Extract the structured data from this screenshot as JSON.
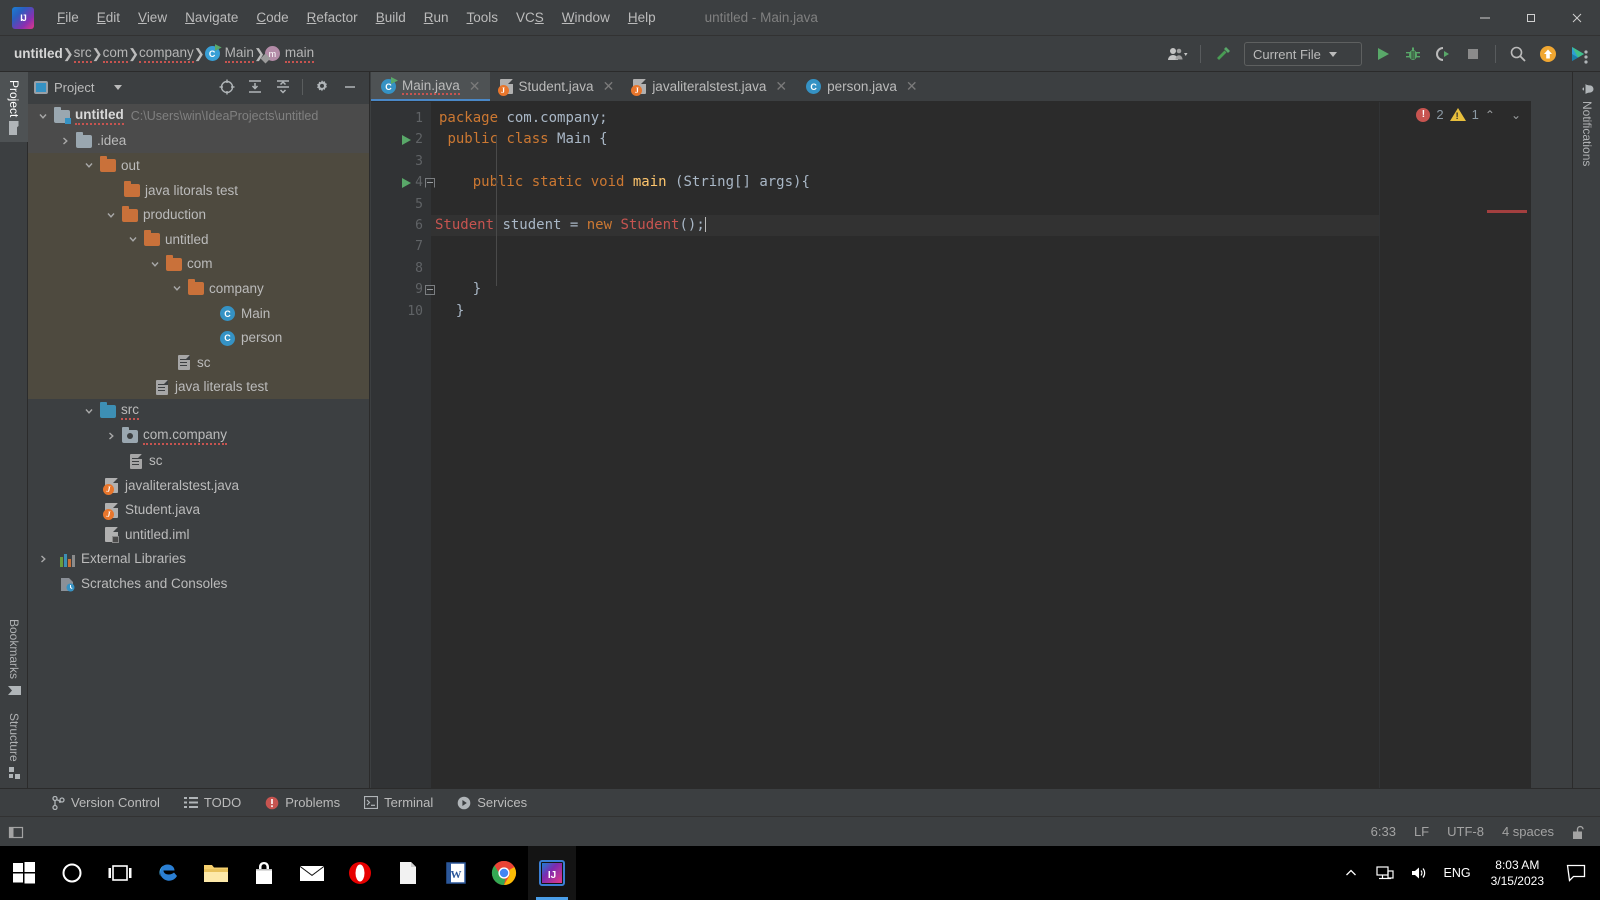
{
  "window": {
    "title": "untitled - Main.java",
    "logo_text": "IJ",
    "controls": {
      "minimize": "—",
      "maximize": "❐",
      "close": "✕"
    }
  },
  "menubar": [
    {
      "label": "File"
    },
    {
      "label": "Edit"
    },
    {
      "label": "View"
    },
    {
      "label": "Navigate"
    },
    {
      "label": "Code"
    },
    {
      "label": "Refactor"
    },
    {
      "label": "Build"
    },
    {
      "label": "Run"
    },
    {
      "label": "Tools"
    },
    {
      "label": "VCS"
    },
    {
      "label": "Window"
    },
    {
      "label": "Help"
    }
  ],
  "breadcrumbs": [
    {
      "label": "untitled",
      "icon": "none",
      "root": true
    },
    {
      "label": "src",
      "icon": "none"
    },
    {
      "label": "com",
      "icon": "none"
    },
    {
      "label": "company",
      "icon": "none"
    },
    {
      "label": "Main",
      "icon": "class-icon"
    },
    {
      "label": "main",
      "icon": "method-icon"
    }
  ],
  "nav_toolbar": {
    "account_icon": "user-icon",
    "build_icon": "hammer-icon",
    "run_config": "Current File",
    "run_icon": "run-icon",
    "debug_icon": "debug-icon",
    "run_coverage_icon": "run-with-coverage-icon",
    "stop_icon": "stop-icon",
    "search_icon": "search-icon",
    "update_icon": "update-available-icon",
    "ide_icon": "ide-services-icon"
  },
  "left_strip": {
    "top": [
      {
        "label": "Project",
        "icon": "project-folder-icon",
        "active": true
      }
    ],
    "bottom": [
      {
        "label": "Bookmarks",
        "icon": "bookmark-icon"
      },
      {
        "label": "Structure",
        "icon": "structure-icon"
      }
    ]
  },
  "right_strip": [
    {
      "label": "Notifications",
      "icon": "bell-icon"
    }
  ],
  "project_panel": {
    "title": "Project",
    "buttons": [
      "select-opened-file-icon",
      "expand-all-icon",
      "collapse-all-icon",
      "settings-gear-icon",
      "hide-icon"
    ],
    "tree": [
      {
        "depth": 0,
        "arrow": "down",
        "icon": "module-folder-icon",
        "label": "untitled",
        "bold": true,
        "path": "C:\\Users\\win\\IdeaProjects\\untitled",
        "squiggle": true,
        "hl": "sel"
      },
      {
        "depth": 1,
        "arrow": "right",
        "icon": "folder-grey-icon",
        "label": ".idea",
        "hl": "sel"
      },
      {
        "depth": 1,
        "arrow": "down",
        "icon": "folder-orange-icon",
        "label": "out",
        "hl": "out"
      },
      {
        "depth": 2,
        "arrow": "none",
        "icon": "folder-orange-icon",
        "label": "java litorals test",
        "hl": "out"
      },
      {
        "depth": 2,
        "arrow": "down",
        "icon": "folder-orange-icon",
        "label": "production",
        "hl": "out"
      },
      {
        "depth": 3,
        "arrow": "down",
        "icon": "folder-orange-icon",
        "label": "untitled",
        "hl": "out"
      },
      {
        "depth": 4,
        "arrow": "down",
        "icon": "folder-orange-icon",
        "label": "com",
        "hl": "out"
      },
      {
        "depth": 5,
        "arrow": "down",
        "icon": "folder-orange-icon",
        "label": "company",
        "hl": "out"
      },
      {
        "depth": 6,
        "arrow": "none",
        "icon": "class-icon",
        "label": "Main",
        "hl": "out"
      },
      {
        "depth": 6,
        "arrow": "none",
        "icon": "class-icon",
        "label": "person",
        "hl": "out"
      },
      {
        "depth": 4,
        "arrow": "none",
        "icon": "file-icon",
        "label": "sc",
        "hl": "out"
      },
      {
        "depth": 3,
        "arrow": "none",
        "icon": "file-icon",
        "label": "java literals test",
        "hl": "out"
      },
      {
        "depth": 1,
        "arrow": "down",
        "icon": "folder-source-icon",
        "label": "src",
        "squiggle": true
      },
      {
        "depth": 2,
        "arrow": "right",
        "icon": "package-icon",
        "label": "com.company",
        "squiggle": true
      },
      {
        "depth": 2,
        "arrow": "none",
        "icon": "file-icon",
        "label": "sc"
      },
      {
        "depth": 1,
        "arrow": "none",
        "icon": "java-file-icon",
        "label": "javaliteralstest.java"
      },
      {
        "depth": 1,
        "arrow": "none",
        "icon": "java-file-icon",
        "label": "Student.java"
      },
      {
        "depth": 1,
        "arrow": "none",
        "icon": "iml-file-icon",
        "label": "untitled.iml"
      },
      {
        "depth": 0,
        "arrow": "right",
        "icon": "external-libraries-icon",
        "label": "External Libraries"
      },
      {
        "depth": 0,
        "arrow": "none",
        "icon": "scratches-icon",
        "label": "Scratches and Consoles"
      }
    ]
  },
  "editor": {
    "tabs": [
      {
        "label": "Main.java",
        "icon": "class-run-icon",
        "active": true,
        "squiggle": true
      },
      {
        "label": "Student.java",
        "icon": "java-file-icon",
        "active": false
      },
      {
        "label": "javaliteralstest.java",
        "icon": "java-file-icon",
        "active": false
      },
      {
        "label": "person.java",
        "icon": "class-icon",
        "active": false
      }
    ],
    "gutter_numbers": [
      "1",
      "2",
      "3",
      "4",
      "5",
      "6",
      "7",
      "8",
      "9",
      "10"
    ],
    "lines": [
      {
        "n": 1,
        "runmark": false,
        "fold": "",
        "tokens": [
          {
            "t": "package ",
            "c": "kw"
          },
          {
            "t": "com.company;",
            "c": "pl"
          }
        ]
      },
      {
        "n": 2,
        "runmark": true,
        "fold": "",
        "tokens": [
          {
            "t": " ",
            "c": "pl"
          },
          {
            "t": "public class ",
            "c": "kw"
          },
          {
            "t": "Main {",
            "c": "pl"
          }
        ]
      },
      {
        "n": 3,
        "runmark": false,
        "fold": "",
        "tokens": []
      },
      {
        "n": 4,
        "runmark": true,
        "fold": "open",
        "tokens": [
          {
            "t": "    ",
            "c": "pl"
          },
          {
            "t": "public static void ",
            "c": "kw"
          },
          {
            "t": "main ",
            "c": "meth"
          },
          {
            "t": "(String[] args){",
            "c": "pl"
          }
        ]
      },
      {
        "n": 5,
        "runmark": false,
        "fold": "",
        "tokens": []
      },
      {
        "n": 6,
        "runmark": false,
        "fold": "",
        "current": true,
        "tokens": [
          {
            "t": "Student",
            "c": "err"
          },
          {
            "t": " student = ",
            "c": "pl"
          },
          {
            "t": "new ",
            "c": "kw"
          },
          {
            "t": "Student",
            "c": "err"
          },
          {
            "t": "();",
            "c": "pl"
          },
          {
            "t": "|",
            "c": "caret"
          }
        ]
      },
      {
        "n": 7,
        "runmark": false,
        "fold": "",
        "tokens": []
      },
      {
        "n": 8,
        "runmark": false,
        "fold": "",
        "tokens": []
      },
      {
        "n": 9,
        "runmark": false,
        "fold": "close",
        "tokens": [
          {
            "t": "    }",
            "c": "pl"
          }
        ]
      },
      {
        "n": 10,
        "runmark": false,
        "fold": "",
        "tokens": [
          {
            "t": "  }",
            "c": "pl"
          }
        ]
      }
    ],
    "inspection": {
      "error_count": "2",
      "warning_count": "1",
      "chevron_up": "∧",
      "chevron_down": "∨"
    },
    "more_icon": "more-vertical-icon"
  },
  "bottom_bar": [
    {
      "label": "Version Control",
      "icon": "branch-icon"
    },
    {
      "label": "TODO",
      "icon": "todo-list-icon"
    },
    {
      "label": "Problems",
      "icon": "problems-icon"
    },
    {
      "label": "Terminal",
      "icon": "terminal-icon"
    },
    {
      "label": "Services",
      "icon": "services-icon"
    }
  ],
  "status_bar": {
    "caret_position": "6:33",
    "line_separator": "LF",
    "encoding": "UTF-8",
    "indent": "4 spaces",
    "lock_icon": "unlocked-icon"
  },
  "taskbar": {
    "icons": [
      {
        "name": "windows-start-icon"
      },
      {
        "name": "cortana-search-icon"
      },
      {
        "name": "task-view-icon"
      },
      {
        "name": "edge-icon"
      },
      {
        "name": "file-explorer-icon"
      },
      {
        "name": "microsoft-store-icon"
      },
      {
        "name": "mail-icon"
      },
      {
        "name": "opera-icon"
      },
      {
        "name": "notepad-icon"
      },
      {
        "name": "word-icon"
      },
      {
        "name": "chrome-icon"
      },
      {
        "name": "intellij-idea-icon",
        "active": true
      }
    ],
    "tray": {
      "chevron": "∧",
      "network_icon": "network-icon",
      "volume_icon": "volume-icon",
      "language": "ENG",
      "time": "8:03 AM",
      "date": "3/15/2023",
      "action_center_icon": "action-center-icon"
    }
  },
  "colors": {
    "panel_bg": "#3c3f41",
    "editor_bg": "#2b2b2b",
    "gutter_bg": "#313335",
    "tab_active": "#4e5254",
    "accent_blue": "#4a88c7",
    "keyword_orange": "#cc7832",
    "error_red": "#c75450",
    "method_yellow": "#ffc66d",
    "folder_orange": "#c9713a",
    "class_blue": "#3592c4",
    "run_green": "#59a869",
    "selection_out": "#4e4a3f"
  }
}
